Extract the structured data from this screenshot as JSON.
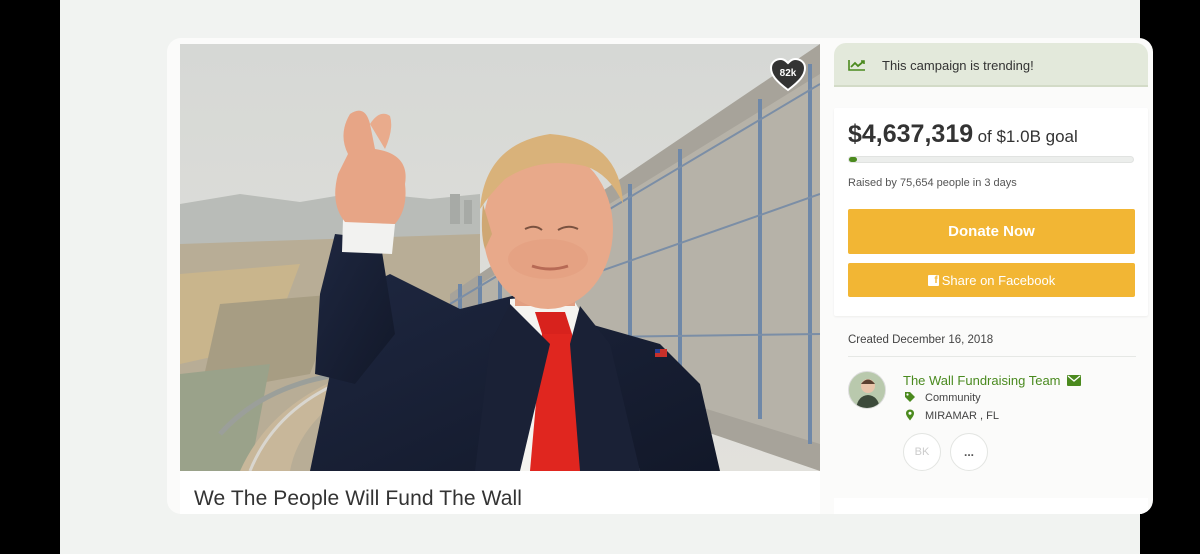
{
  "hero": {
    "likes": "82k",
    "image_alt": "Donald Trump giving a thumbs up in front of the border wall"
  },
  "campaign": {
    "title": "We The People Will Fund The Wall"
  },
  "trending": {
    "text": "This campaign is trending!"
  },
  "funding": {
    "amount": "$4,637,319",
    "goal": "of $1.0B goal",
    "progress_fraction": 0.0046,
    "raised_text": "Raised by 75,654 people in 3 days",
    "donate_label": "Donate Now",
    "share_label": "Share on Facebook"
  },
  "created": "Created December 16, 2018",
  "organizer": {
    "name": "The Wall Fundraising Team",
    "category": "Community",
    "location": "MIRAMAR , FL",
    "initials": "BK",
    "more_label": "..."
  },
  "colors": {
    "accent_green": "#4b8a1e",
    "button_yellow": "#f2b634",
    "trend_banner": "#e3e9db"
  }
}
